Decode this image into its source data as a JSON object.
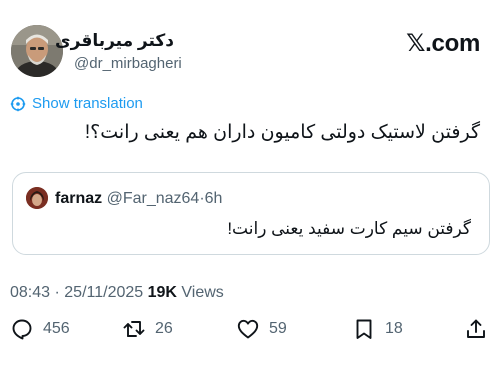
{
  "author": {
    "display_name": "دکتر میرباقری",
    "handle": "@dr_mirbagheri"
  },
  "brand": {
    "label": "𝕏.com"
  },
  "translate": {
    "label": "Show translation"
  },
  "tweet": {
    "text": "گرفتن لاستیک دولتی کامیون داران هم یعنی رانت؟!"
  },
  "quote": {
    "name": "farnaz",
    "handle": "@Far_naz64",
    "separator": "·",
    "time": "6h",
    "text": "گرفتن سیم کارت سفید یعنی رانت!"
  },
  "meta": {
    "time": "08:43",
    "separator": " · ",
    "date": "25/11/2025",
    "views_count": "19K",
    "views_label": " Views"
  },
  "actions": {
    "replies": "456",
    "retweets": "26",
    "likes": "59",
    "bookmarks": "18"
  },
  "colors": {
    "link": "#1d9bf0",
    "secondary_text": "#536471",
    "primary_text": "#0f1419",
    "border": "#cfd9de"
  }
}
